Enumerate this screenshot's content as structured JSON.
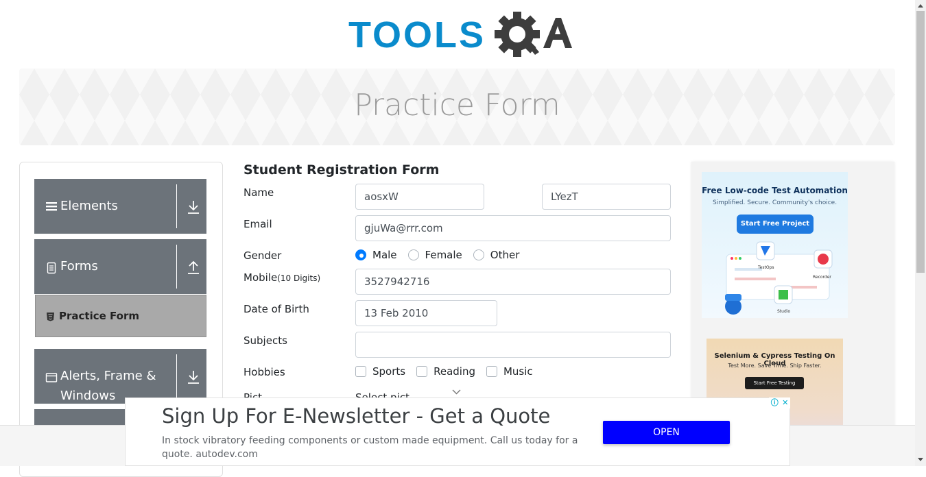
{
  "logo": {
    "text_left": "TOOLS",
    "text_right": "A"
  },
  "banner": {
    "title": "Practice Form"
  },
  "sidebar": {
    "groups": [
      {
        "label": "Elements",
        "icon": "hamburger-icon",
        "toggle": "download-arrow-icon"
      },
      {
        "label": "Forms",
        "icon": "document-icon",
        "toggle": "upload-arrow-icon"
      },
      {
        "label_line1": "Alerts, Frame &",
        "label_line2": "Windows",
        "icon": "window-icon",
        "toggle": "download-arrow-icon"
      }
    ],
    "active_item": {
      "label": "Practice Form",
      "icon": "html5-icon"
    }
  },
  "form": {
    "title": "Student Registration Form",
    "name_label": "Name",
    "first_name": "aosxW",
    "last_name": "LYezT",
    "email_label": "Email",
    "email": "gjuWa@rrr.com",
    "gender_label": "Gender",
    "gender_options": [
      "Male",
      "Female",
      "Other"
    ],
    "gender_selected": "Male",
    "mobile_label": "Mobile",
    "mobile_hint": "(10 Digits)",
    "mobile": "3527942716",
    "dob_label": "Date of Birth",
    "dob": "13 Feb 2010",
    "subjects_label": "Subjects",
    "subjects": "",
    "hobbies_label": "Hobbies",
    "hobbies": [
      "Sports",
      "Reading",
      "Music"
    ],
    "picture_label_partial": "Pict",
    "picture_value_partial": "Select pict"
  },
  "right_ads": {
    "ad1": {
      "headline": "Free Low-code Test Automation",
      "sub": "Simplified. Secure. Community's choice.",
      "button": "Start Free Project",
      "labels": [
        "TestOps",
        "Recorder",
        "Studio"
      ]
    },
    "ad2": {
      "headline": "Selenium & Cypress Testing On Cloud",
      "sub": "Test More. Save Time. Ship Faster.",
      "button": "Start Free Testing"
    }
  },
  "bottom_ad": {
    "headline": "Sign Up For E-Newsletter - Get a Quote",
    "description": "In stock vibratory feeding components or custom made equipment. Call us today for a quote. autodev.com",
    "button": "OPEN",
    "adchoices_icons": [
      "info-icon",
      "close-icon"
    ]
  },
  "colors": {
    "sidebar_group": "#6c737a",
    "active_item": "#a9a9a9",
    "radio_checked": "#007bff",
    "ad_button": "#0000ff",
    "logo_blue": "#0a8bcc",
    "logo_dark": "#3d3d3d"
  }
}
